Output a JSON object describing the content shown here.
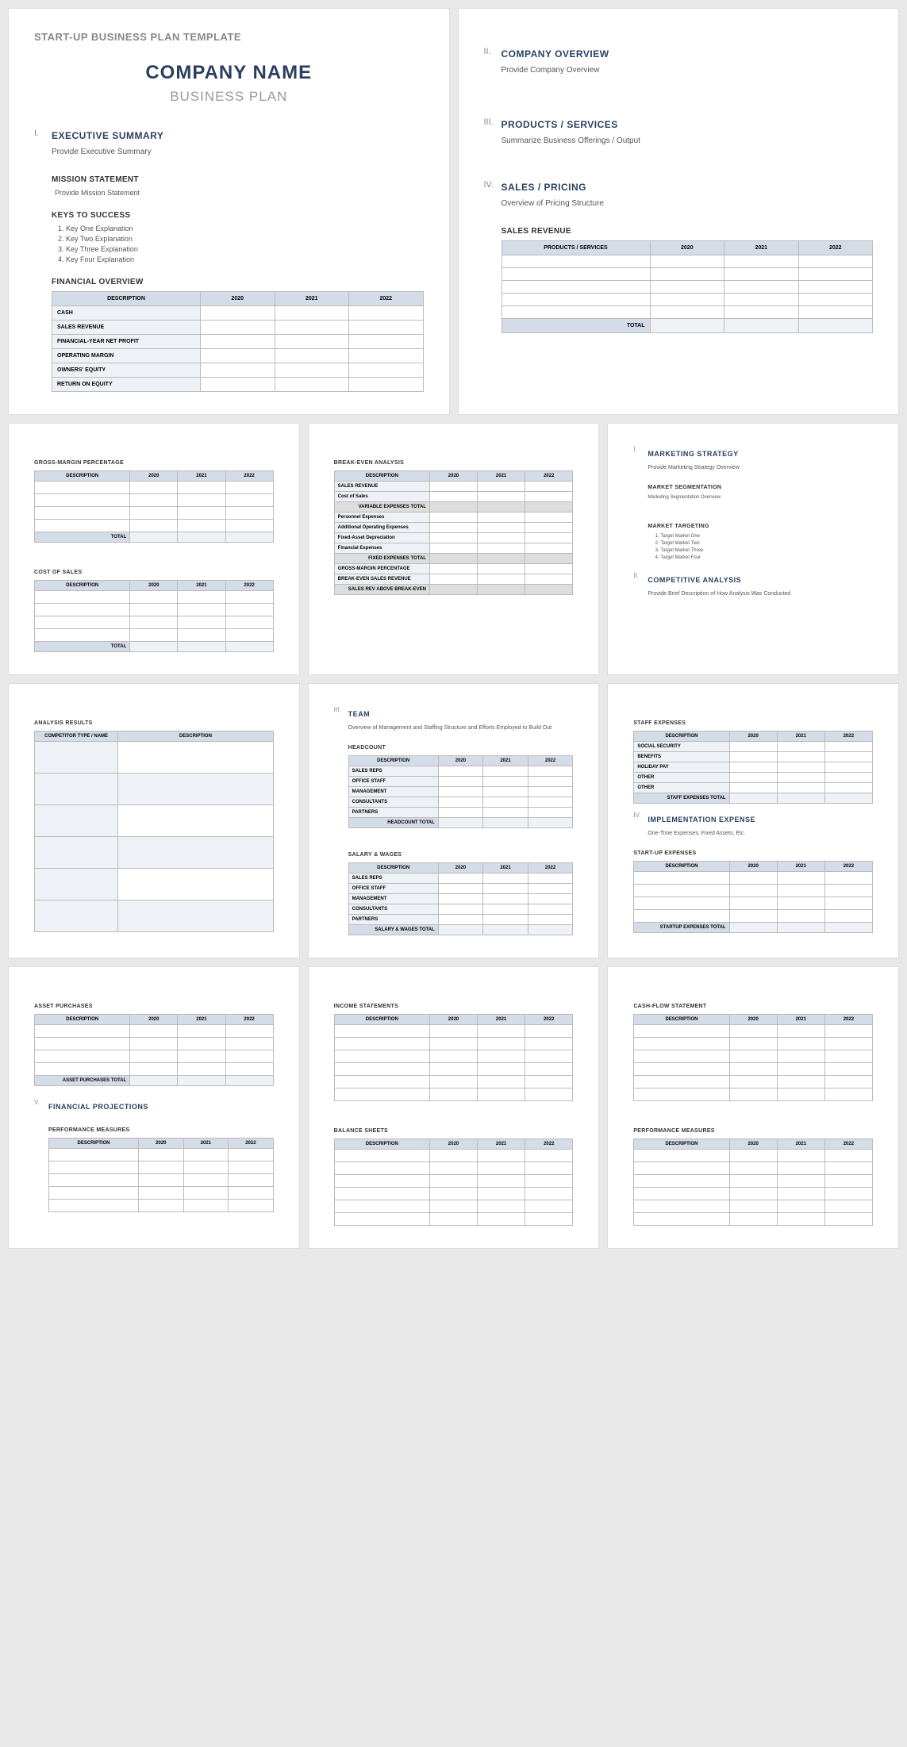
{
  "tmpl_title": "START-UP BUSINESS PLAN TEMPLATE",
  "company": "COMPANY NAME",
  "bplan": "BUSINESS PLAN",
  "y1": "2020",
  "y2": "2021",
  "y3": "2022",
  "desc": "DESCRIPTION",
  "s1": {
    "num": "I.",
    "h": "EXECUTIVE SUMMARY",
    "body": "Provide Executive Summary"
  },
  "mission": {
    "h": "MISSION STATEMENT",
    "body": "Provide Mission Statement"
  },
  "keys": {
    "h": "KEYS TO SUCCESS",
    "items": [
      "Key One Explanation",
      "Key Two Explanation",
      "Key Three Explanation",
      "Key Four Explanation"
    ]
  },
  "finov": {
    "h": "FINANCIAL OVERVIEW",
    "rows": [
      "CASH",
      "SALES REVENUE",
      "FINANCIAL-YEAR NET PROFIT",
      "OPERATING MARGIN",
      "OWNERS' EQUITY",
      "RETURN ON EQUITY"
    ]
  },
  "s2": {
    "num": "II.",
    "h": "COMPANY OVERVIEW",
    "body": "Provide Company Overview"
  },
  "s3": {
    "num": "III.",
    "h": "PRODUCTS / SERVICES",
    "body": "Summarize Business Offerings / Output"
  },
  "s4": {
    "num": "IV.",
    "h": "SALES / PRICING",
    "body": "Overview of Pricing Structure"
  },
  "salesrev": {
    "h": "SALES REVENUE",
    "col": "PRODUCTS / SERVICES",
    "tot": "TOTAL"
  },
  "gmp": {
    "h": "GROSS-MARGIN PERCENTAGE",
    "tot": "TOTAL"
  },
  "cos": {
    "h": "COST OF SALES",
    "tot": "TOTAL"
  },
  "bea": {
    "h": "BREAK-EVEN ANALYSIS",
    "rows": [
      "SALES REVENUE",
      "Cost of Sales",
      "Personnel Expenses",
      "Additional Operating Expenses",
      "Fixed-Asset Depreciation",
      "Financial Expenses",
      "GROSS-MARGIN PERCENTAGE",
      "BREAK-EVEN SALES REVENUE"
    ],
    "vt": "VARIABLE EXPENSES TOTAL",
    "ft": "FIXED EXPENSES TOTAL",
    "sra": "SALES REV ABOVE BREAK-EVEN"
  },
  "mkt": {
    "n1": "I.",
    "h1": "MARKETING STRATEGY",
    "b1": "Provide Marketing Strategy Overview",
    "h2": "MARKET SEGMENTATION",
    "b2": "Marketing Segmentation Overview",
    "h3": "MARKET TARGETING",
    "items": [
      "Target Market One",
      "Target Market Two",
      "Target Market Three",
      "Target Market Four"
    ],
    "n2": "II.",
    "h4": "COMPETITIVE ANALYSIS",
    "b4": "Provide Brief Description of How Analysis Was Conducted"
  },
  "ar": {
    "h": "ANALYSIS RESULTS",
    "c1": "COMPETITOR TYPE / NAME",
    "c2": "DESCRIPTION"
  },
  "team": {
    "num": "III.",
    "h": "TEAM",
    "body": "Overview of Management and Staffing Structure and Efforts Employed to Build Out"
  },
  "hc": {
    "h": "HEADCOUNT",
    "rows": [
      "SALES REPS",
      "OFFICE STAFF",
      "MANAGEMENT",
      "CONSULTANTS",
      "PARTNERS"
    ],
    "tot": "HEADCOUNT TOTAL"
  },
  "sw": {
    "h": "SALARY & WAGES",
    "rows": [
      "SALES REPS",
      "OFFICE STAFF",
      "MANAGEMENT",
      "CONSULTANTS",
      "PARTNERS"
    ],
    "tot": "SALARY & WAGES TOTAL"
  },
  "se": {
    "h": "STAFF EXPENSES",
    "rows": [
      "SOCIAL SECURITY",
      "BENEFITS",
      "HOLIDAY PAY",
      "OTHER",
      "OTHER"
    ],
    "tot": "STAFF EXPENSES TOTAL"
  },
  "ie": {
    "num": "IV.",
    "h": "IMPLEMENTATION EXPENSE",
    "body": "One-Time Expenses, Fixed Assets, Etc."
  },
  "sue": {
    "h": "START-UP EXPENSES",
    "tot": "STARTUP EXPENSES TOTAL"
  },
  "ap": {
    "h": "ASSET PURCHASES",
    "tot": "ASSET PURCHASES TOTAL"
  },
  "fp": {
    "num": "V.",
    "h": "FINANCIAL PROJECTIONS"
  },
  "pm": {
    "h": "PERFORMANCE MEASURES"
  },
  "is": {
    "h": "INCOME STATEMENTS"
  },
  "bs": {
    "h": "BALANCE SHEETS"
  },
  "cfs": {
    "h": "CASH-FLOW STATEMENT"
  }
}
